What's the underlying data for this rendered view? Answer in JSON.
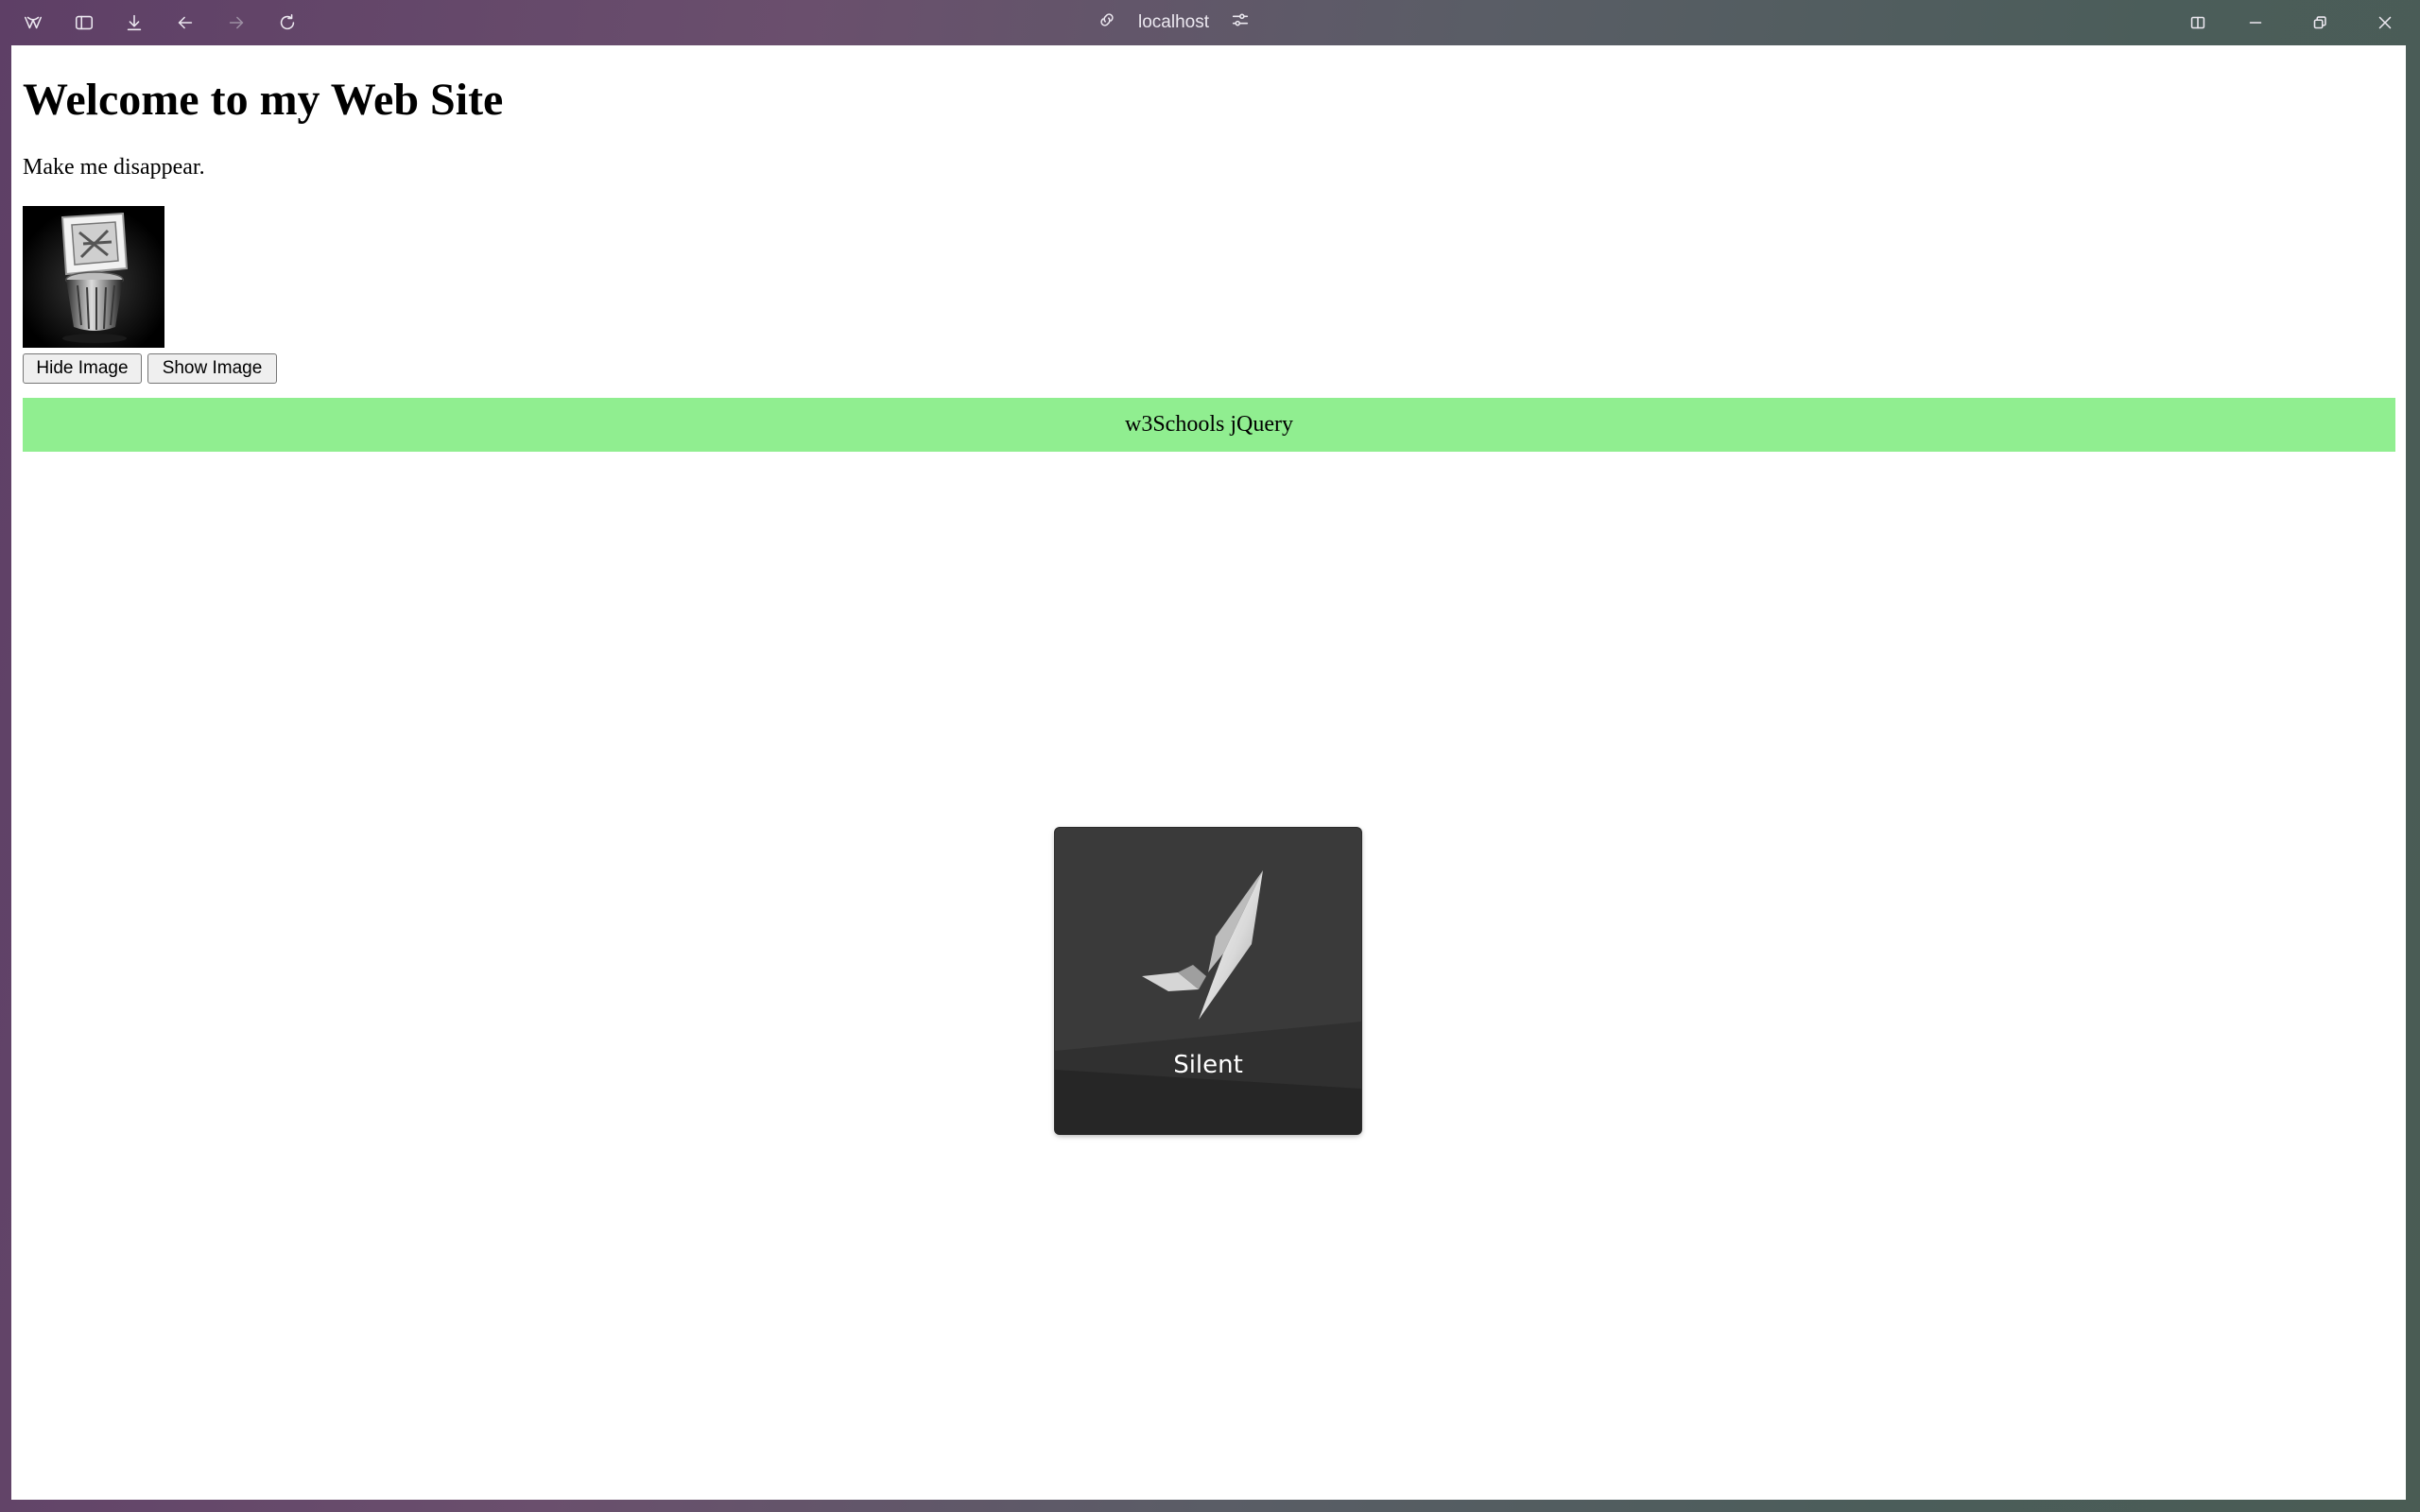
{
  "browser": {
    "address": "localhost",
    "icons": [
      "browser-logo-icon",
      "sidebar-icon",
      "download-icon",
      "back-icon",
      "forward-icon",
      "reload-icon",
      "link-icon",
      "site-settings-icon",
      "split-view-icon",
      "minimize-icon",
      "restore-icon",
      "close-icon"
    ]
  },
  "page": {
    "heading": "Welcome to my Web Site",
    "paragraph": "Make me disappear.",
    "hide_button": "Hide Image",
    "show_button": "Show Image",
    "banner": "w3Schools jQuery",
    "banner_color": "#90ee90"
  },
  "overlay": {
    "label": "Silent",
    "icon": "feather-icon"
  }
}
